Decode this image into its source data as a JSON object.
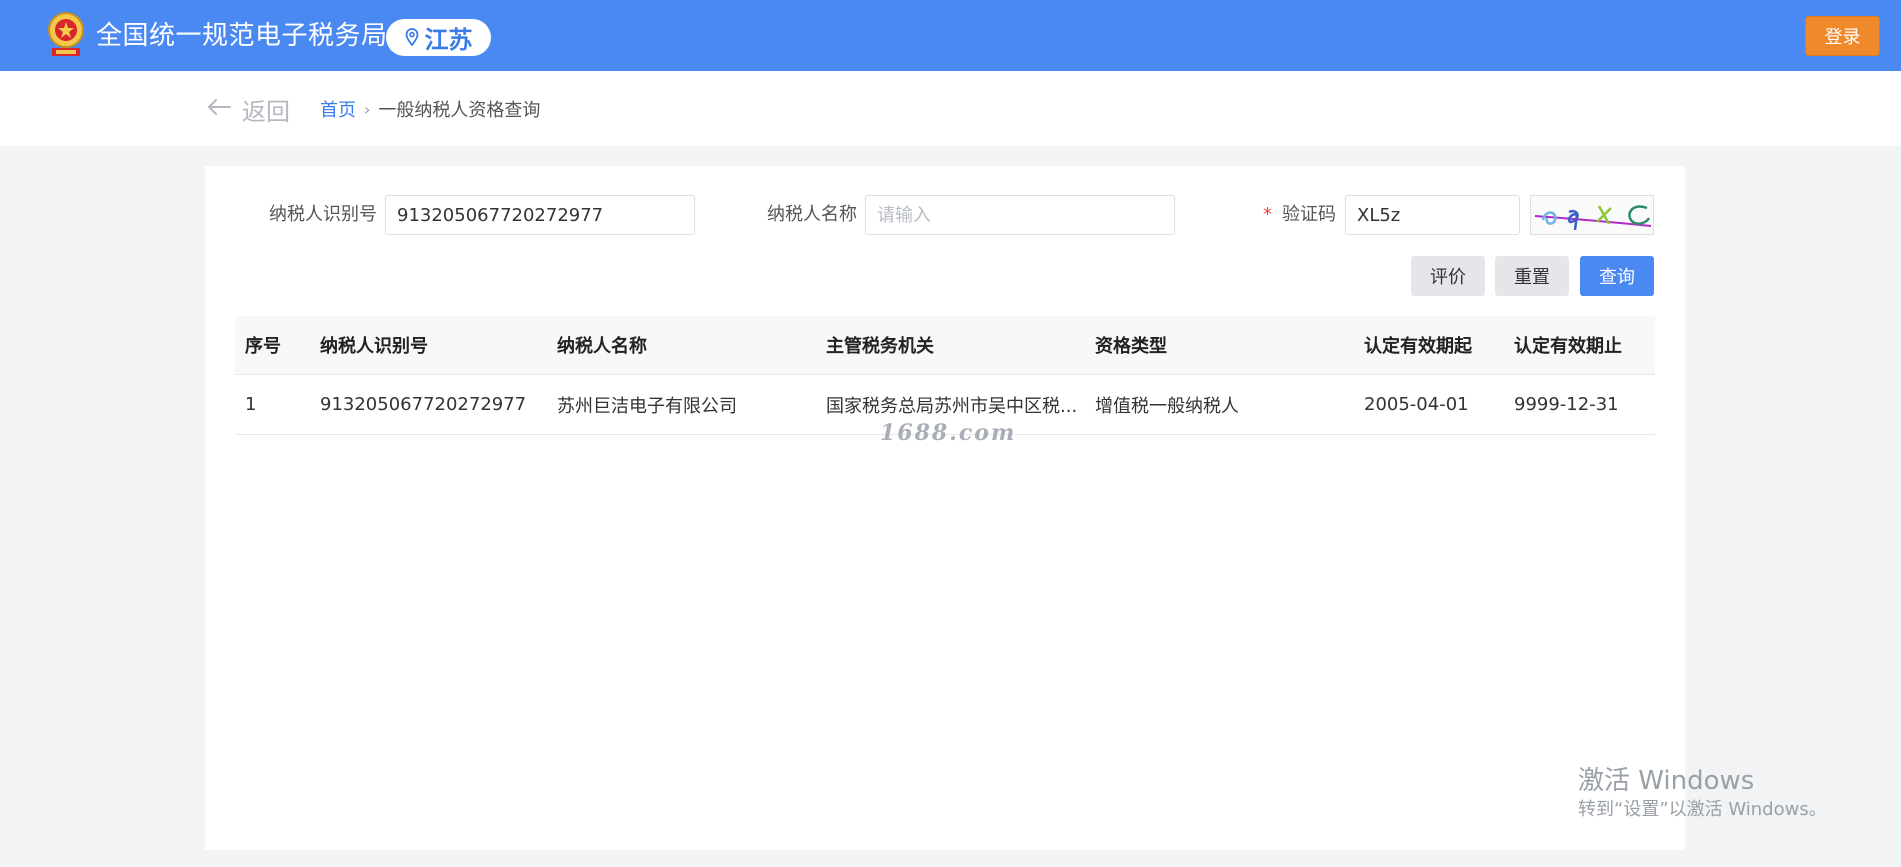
{
  "header": {
    "site_title": "全国统一规范电子税务局",
    "region": "江苏",
    "login_label": "登录",
    "brand_color": "#4a88f2",
    "login_color": "#f0892a"
  },
  "breadcrumb": {
    "back_label": "返回",
    "home": "首页",
    "separator": "›",
    "current": "一般纳税人资格查询"
  },
  "form": {
    "taxpayer_id_label": "纳税人识别号",
    "taxpayer_id_value": "913205067720272977",
    "taxpayer_name_label": "纳税人名称",
    "taxpayer_name_placeholder": "请输入",
    "captcha_label": "验证码",
    "captcha_required": "*",
    "captcha_value": "XL5z"
  },
  "buttons": {
    "evaluate": "评价",
    "reset": "重置",
    "query": "查询"
  },
  "table": {
    "columns": [
      "序号",
      "纳税人识别号",
      "纳税人名称",
      "主管税务机关",
      "资格类型",
      "认定有效期起",
      "认定有效期止"
    ],
    "rows": [
      [
        "1",
        "913205067720272977",
        "苏州巨洁电子有限公司",
        "国家税务总局苏州市吴中区税...",
        "增值税一般纳税人",
        "2005-04-01",
        "9999-12-31"
      ]
    ]
  },
  "overlay": {
    "watermark": "1688.com",
    "windows_activate_title": "激活 Windows",
    "windows_activate_hint": "转到“设置”以激活 Windows。"
  }
}
